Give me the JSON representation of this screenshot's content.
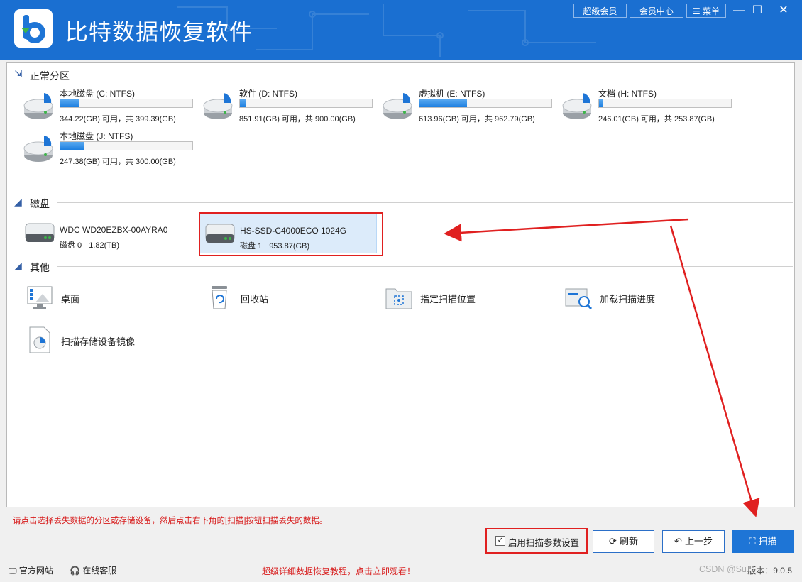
{
  "app": {
    "title": "比特数据恢复软件"
  },
  "header": {
    "super_member": "超级会员",
    "member_center": "会员中心",
    "menu": "菜单",
    "minimize": "—",
    "maximize": "☐",
    "close": "✕"
  },
  "sections": {
    "partitions": "正常分区",
    "disks": "磁盘",
    "others": "其他"
  },
  "partitions": [
    {
      "name": "本地磁盘 (C: NTFS)",
      "size": "344.22(GB) 可用，共 399.39(GB)",
      "used_pct": 14
    },
    {
      "name": "软件 (D: NTFS)",
      "size": "851.91(GB) 可用，共 900.00(GB)",
      "used_pct": 5
    },
    {
      "name": "虚拟机 (E: NTFS)",
      "size": "613.96(GB) 可用，共 962.79(GB)",
      "used_pct": 36
    },
    {
      "name": "文档 (H: NTFS)",
      "size": "246.01(GB) 可用，共 253.87(GB)",
      "used_pct": 3
    },
    {
      "name": "本地磁盘 (J: NTFS)",
      "size": "247.38(GB) 可用，共 300.00(GB)",
      "used_pct": 18
    }
  ],
  "disks": [
    {
      "name": "WDC WD20EZBX-00AYRA0",
      "label": "磁盘 0",
      "capacity": "1.82(TB)",
      "selected": false
    },
    {
      "name": "HS-SSD-C4000ECO 1024G",
      "label": "磁盘 1",
      "capacity": "953.87(GB)",
      "selected": true
    }
  ],
  "others": [
    {
      "name": "桌面",
      "icon": "desktop-icon"
    },
    {
      "name": "回收站",
      "icon": "recycle-bin-icon"
    },
    {
      "name": "指定扫描位置",
      "icon": "folder-target-icon"
    },
    {
      "name": "加载扫描进度",
      "icon": "load-progress-icon"
    },
    {
      "name": "扫描存储设备镜像",
      "icon": "disk-image-icon"
    }
  ],
  "hint": "请点击选择丢失数据的分区或存储设备，然后点击右下角的[扫描]按钮扫描丢失的数据。",
  "actions": {
    "scan_params": "启用扫描参数设置",
    "scan_params_checked": true,
    "refresh": "刷新",
    "prev": "上一步",
    "scan": "扫描"
  },
  "footer": {
    "website": "官方网站",
    "support": "在线客服",
    "tutorial": "超级详细数据恢复教程，点击立即观看！",
    "version": "版本：9.0.5",
    "watermark": "CSDN @Su..."
  },
  "colors": {
    "accent": "#1e75d6",
    "title_bar": "#1a6fd1",
    "warning": "#d71a1a",
    "annotation": "#e02020"
  }
}
